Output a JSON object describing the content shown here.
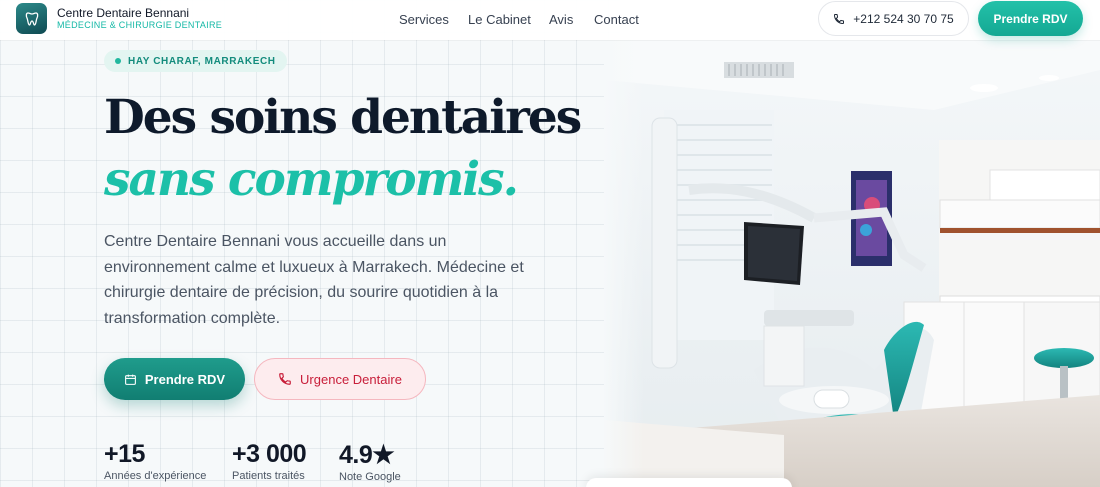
{
  "brand": {
    "name": "Centre Dentaire Bennani",
    "tagline": "MÉDECINE & CHIRURGIE DENTAIRE",
    "logo_icon": "tooth-icon"
  },
  "nav": {
    "links": [
      "Services",
      "Le Cabinet",
      "Avis",
      "Contact"
    ],
    "phone": "+212 524 30 70 75",
    "cta": "Prendre RDV"
  },
  "hero": {
    "location": "HAY CHARAF, MARRAKECH",
    "title_line1": "Des soins dentaires",
    "title_line2": "sans compromis.",
    "description": "Centre Dentaire Bennani vous accueille dans un environnement calme et luxueux à Marrakech. Médecine et chirurgie dentaire de précision, du sourire quotidien à la transformation complète.",
    "primary_cta": "Prendre RDV",
    "secondary_cta": "Urgence Dentaire"
  },
  "stats": [
    {
      "value": "+15",
      "label": "Années d'expérience"
    },
    {
      "value": "+3 000",
      "label": "Patients traités"
    },
    {
      "value": "4.9★",
      "label": "Note Google"
    }
  ],
  "colors": {
    "accent": "#1cc0a8",
    "accent_dark": "#117e72",
    "title": "#0e1a2b",
    "emergency": "#c81e3a"
  }
}
